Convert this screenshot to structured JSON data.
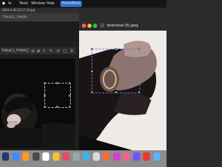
{
  "menubar": {
    "apple": "",
    "items": [
      "le",
      "Tools",
      "Window",
      "Help"
    ],
    "badge": "PhotoMosh"
  },
  "window1": {
    "tab_title": "2024-4-26 23:27 19.jpg",
    "filename": "7TBG4C1_7FM5PI...",
    "title": "7FBG4C1_7FM5PI..."
  },
  "window2": {
    "title": "download (6).jpeg"
  },
  "dock": {
    "icon_colors": [
      "#1e3c6e",
      "#3d8cff",
      "#ff9a1a",
      "#4a4a4a",
      "#ffffff",
      "#f1c232",
      "#e84a5f",
      "#9aa4ad",
      "#3bb3e8",
      "#d9d9d9",
      "#ff6a3d",
      "#d13fd0",
      "#ff5d8f",
      "#7c4dff",
      "#e83a2a",
      "#5fb0ff"
    ]
  }
}
